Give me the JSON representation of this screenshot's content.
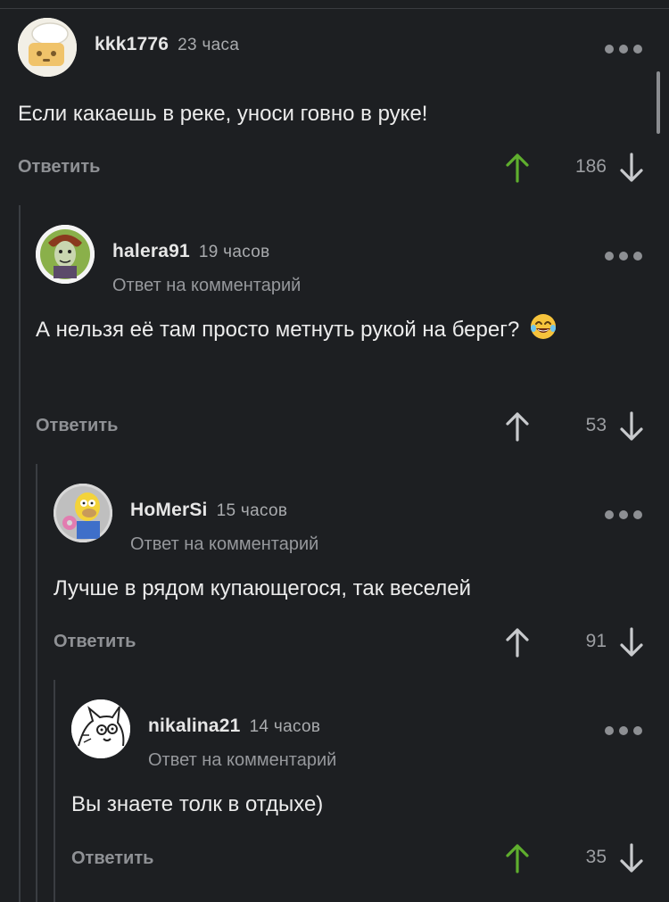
{
  "comments": [
    {
      "username": "kkk1776",
      "time": "23 часа",
      "reply_note": "",
      "text": "Если какаешь в реке, уноси говно в руке!",
      "reply_label": "Ответить",
      "score": "186",
      "upvoted": true
    },
    {
      "username": "halera91",
      "time": "19 часов",
      "reply_note": "Ответ на комментарий",
      "text": "А нельзя её там просто метнуть рукой на берег?",
      "reply_label": "Ответить",
      "score": "53",
      "upvoted": false
    },
    {
      "username": "HoMerSi",
      "time": "15 часов",
      "reply_note": "Ответ на комментарий",
      "text": "Лучше в рядом купающегося, так веселей",
      "reply_label": "Ответить",
      "score": "91",
      "upvoted": false
    },
    {
      "username": "nikalina21",
      "time": "14 часов",
      "reply_note": "Ответ на комментарий",
      "text": "Вы знаете толк в отдыхе)",
      "reply_label": "Ответить",
      "score": "35",
      "upvoted": true
    }
  ],
  "colors": {
    "background": "#1d1f22",
    "upvote_active": "#5fae2e",
    "arrow_default": "#c8cacd",
    "thread_line": "#3a3d42"
  },
  "icons": [
    "more-dots-icon",
    "upvote-arrow-icon",
    "downvote-arrow-icon",
    "laughing-tears-emoji"
  ]
}
